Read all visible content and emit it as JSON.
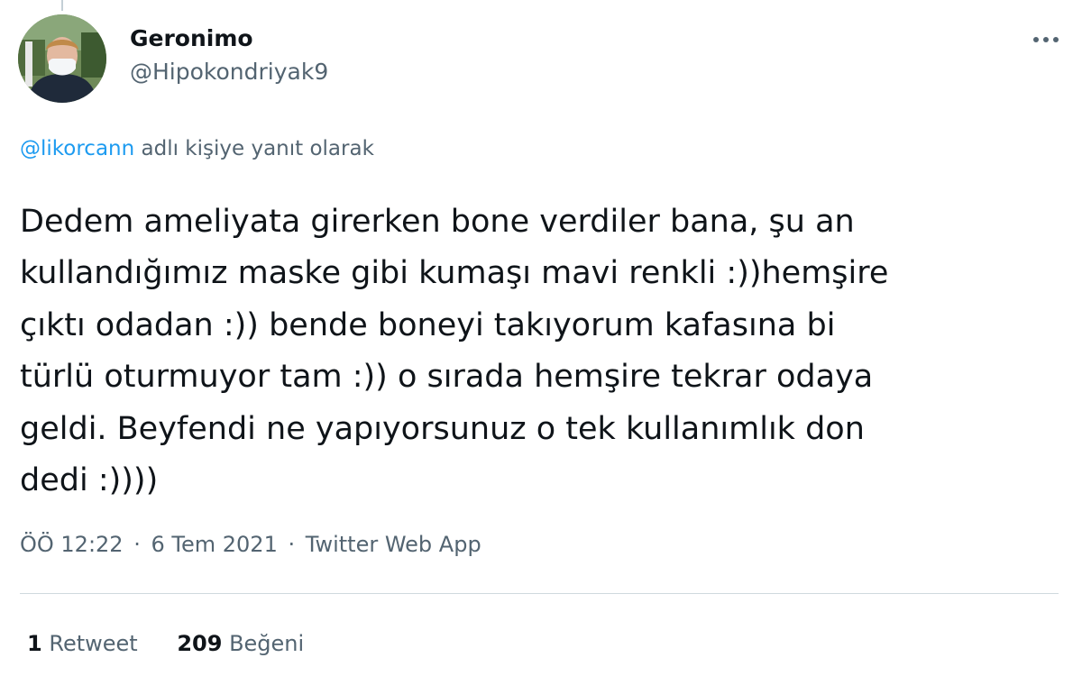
{
  "tweet": {
    "author": {
      "display_name": "Geronimo",
      "handle": "@Hipokondriyak9"
    },
    "reply_to": {
      "mention": "@likorcann",
      "suffix": " adlı kişiye yanıt olarak"
    },
    "text": "Dedem ameliyata girerken bone verdiler bana, şu an\nkullandığımız maske gibi kumaşı mavi renkli :))hemşire\nçıktı odadan :)) bende boneyi takıyorum kafasına bi\ntürlü oturmuyor tam :)) o sırada hemşire tekrar odaya\ngeldi. Beyfendi ne yapıyorsunuz o tek kullanımlık don\ndedi :))))",
    "time": "ÖÖ 12:22",
    "separator": "·",
    "date": "6 Tem 2021",
    "source": "Twitter Web App",
    "stats": {
      "retweet_count": "1",
      "retweet_label": "Retweet",
      "like_count": "209",
      "like_label": "Beğeni"
    }
  },
  "icons": {
    "more": "more-horizontal-icon"
  },
  "colors": {
    "accent": "#1d9bf0",
    "text_primary": "#0f1419",
    "text_secondary": "#536471",
    "divider": "#cfd9de"
  }
}
